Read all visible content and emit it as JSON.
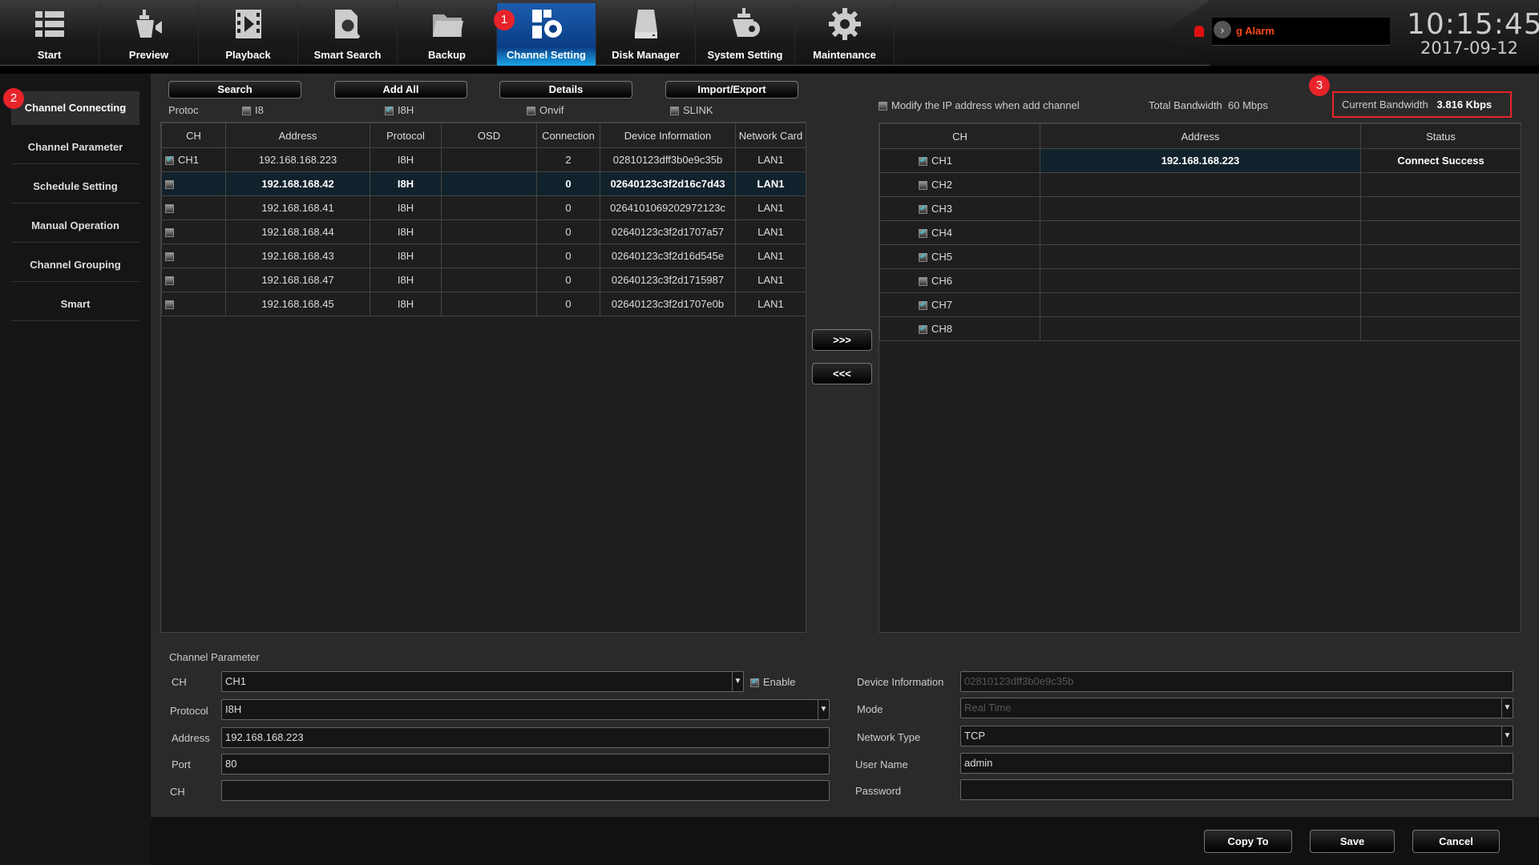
{
  "nav": [
    {
      "label": "Start",
      "icon": "list-icon"
    },
    {
      "label": "Preview",
      "icon": "camera-icon"
    },
    {
      "label": "Playback",
      "icon": "film-icon"
    },
    {
      "label": "Smart Search",
      "icon": "search-document-icon"
    },
    {
      "label": "Backup",
      "icon": "folder-icon"
    },
    {
      "label": "Channel Setting",
      "icon": "channel-gear-icon",
      "active": true
    },
    {
      "label": "Disk Manager",
      "icon": "disk-icon"
    },
    {
      "label": "System Setting",
      "icon": "system-gear-icon"
    },
    {
      "label": "Maintenance",
      "icon": "gear-icon"
    }
  ],
  "badges": {
    "one": "1",
    "two": "2",
    "three": "3"
  },
  "alarm": {
    "text": "g Alarm"
  },
  "clock": {
    "time": "10:15:45",
    "date": "2017-09-12"
  },
  "sidebar": {
    "items": [
      {
        "label": "Channel Connecting",
        "active": true
      },
      {
        "label": "Channel Parameter"
      },
      {
        "label": "Schedule Setting"
      },
      {
        "label": "Manual Operation"
      },
      {
        "label": "Channel Grouping"
      },
      {
        "label": "Smart"
      }
    ]
  },
  "toolbar": {
    "search": "Search",
    "add_all": "Add All",
    "details": "Details",
    "import_export": "Import/Export"
  },
  "protocol_filter": {
    "label": "Protoc",
    "options": [
      {
        "label": "I8",
        "checked": false
      },
      {
        "label": "I8H",
        "checked": true
      },
      {
        "label": "Onvif",
        "checked": false
      },
      {
        "label": "SLINK",
        "checked": false
      }
    ]
  },
  "device_table": {
    "headers": [
      "CH",
      "Address",
      "Protocol",
      "OSD",
      "Connection",
      "Device Information",
      "Network Card"
    ],
    "rows": [
      {
        "checked": true,
        "ch": "CH1",
        "address": "192.168.168.223",
        "protocol": "I8H",
        "osd": "",
        "connections": "2",
        "device_info": "02810123dff3b0e9c35b",
        "network_card": "LAN1"
      },
      {
        "checked": false,
        "ch": "",
        "address": "192.168.168.42",
        "protocol": "I8H",
        "osd": "",
        "connections": "0",
        "device_info": "02640123c3f2d16c7d43",
        "network_card": "LAN1",
        "selected": true
      },
      {
        "checked": false,
        "ch": "",
        "address": "192.168.168.41",
        "protocol": "I8H",
        "osd": "",
        "connections": "0",
        "device_info": "0264101069202972123c",
        "network_card": "LAN1"
      },
      {
        "checked": false,
        "ch": "",
        "address": "192.168.168.44",
        "protocol": "I8H",
        "osd": "",
        "connections": "0",
        "device_info": "02640123c3f2d1707a57",
        "network_card": "LAN1"
      },
      {
        "checked": false,
        "ch": "",
        "address": "192.168.168.43",
        "protocol": "I8H",
        "osd": "",
        "connections": "0",
        "device_info": "02640123c3f2d16d545e",
        "network_card": "LAN1"
      },
      {
        "checked": false,
        "ch": "",
        "address": "192.168.168.47",
        "protocol": "I8H",
        "osd": "",
        "connections": "0",
        "device_info": "02640123c3f2d1715987",
        "network_card": "LAN1"
      },
      {
        "checked": false,
        "ch": "",
        "address": "192.168.168.45",
        "protocol": "I8H",
        "osd": "",
        "connections": "0",
        "device_info": "02640123c3f2d1707e0b",
        "network_card": "LAN1"
      }
    ]
  },
  "transfer": {
    "add": ">>>",
    "remove": "<<<"
  },
  "bandwidth": {
    "modify_ip_label": "Modify the IP address when add channel",
    "modify_ip_checked": false,
    "total_label": "Total Bandwidth",
    "total_value": "60 Mbps",
    "current_label": "Current Bandwidth",
    "current_value": "3.816 Kbps"
  },
  "channel_table": {
    "headers": [
      "CH",
      "Address",
      "Status"
    ],
    "rows": [
      {
        "checked": true,
        "ch": "CH1",
        "address": "192.168.168.223",
        "status": "Connect Success"
      },
      {
        "checked": false,
        "ch": "CH2",
        "address": "",
        "status": ""
      },
      {
        "checked": true,
        "ch": "CH3",
        "address": "",
        "status": ""
      },
      {
        "checked": true,
        "ch": "CH4",
        "address": "",
        "status": ""
      },
      {
        "checked": true,
        "ch": "CH5",
        "address": "",
        "status": ""
      },
      {
        "checked": false,
        "ch": "CH6",
        "address": "",
        "status": ""
      },
      {
        "checked": true,
        "ch": "CH7",
        "address": "",
        "status": ""
      },
      {
        "checked": true,
        "ch": "CH8",
        "address": "",
        "status": ""
      }
    ]
  },
  "channel_parameter": {
    "title": "Channel Parameter",
    "ch_label": "CH",
    "ch_value": "CH1",
    "enable_label": "Enable",
    "enable_checked": true,
    "protocol_label": "Protocol",
    "protocol_value": "I8H",
    "address_label": "Address",
    "address_value": "192.168.168.223",
    "port_label": "Port",
    "port_value": "80",
    "ch2_label": "CH",
    "ch2_value": "",
    "device_info_label": "Device Information",
    "device_info_value": "02810123dff3b0e9c35b",
    "mode_label": "Mode",
    "mode_value": "Real Time",
    "network_type_label": "Network Type",
    "network_type_value": "TCP",
    "user_name_label": "User Name",
    "user_name_value": "admin",
    "password_label": "Password",
    "password_value": ""
  },
  "footer": {
    "copy_to": "Copy To",
    "save": "Save",
    "cancel": "Cancel"
  },
  "colors": {
    "accent": "#0a3d86",
    "badge": "#e8232a",
    "alarm_text": "#ff4a1a",
    "highlight_box": "#e8232a"
  }
}
